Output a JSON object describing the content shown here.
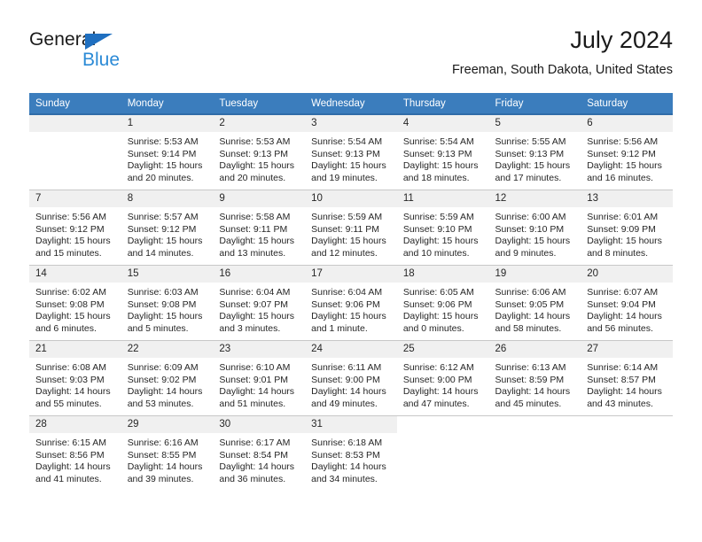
{
  "brand": {
    "name_dark": "General",
    "name_light": "Blue",
    "triangle_color": "#1f6fc0",
    "light_color": "#2b8ad6"
  },
  "header": {
    "title": "July 2024",
    "subtitle": "Freeman, South Dakota, United States"
  },
  "theme": {
    "header_bg": "#3b7dbd",
    "header_text": "#ffffff",
    "daynum_bg": "#f0f0f0",
    "row_divider": "#c8c8c8"
  },
  "weekdays": [
    "Sunday",
    "Monday",
    "Tuesday",
    "Wednesday",
    "Thursday",
    "Friday",
    "Saturday"
  ],
  "weeks": [
    [
      {
        "day": "",
        "sunrise": "",
        "sunset": "",
        "daylight1": "",
        "daylight2": "",
        "blank": true
      },
      {
        "day": "1",
        "sunrise": "Sunrise: 5:53 AM",
        "sunset": "Sunset: 9:14 PM",
        "daylight1": "Daylight: 15 hours",
        "daylight2": "and 20 minutes."
      },
      {
        "day": "2",
        "sunrise": "Sunrise: 5:53 AM",
        "sunset": "Sunset: 9:13 PM",
        "daylight1": "Daylight: 15 hours",
        "daylight2": "and 20 minutes."
      },
      {
        "day": "3",
        "sunrise": "Sunrise: 5:54 AM",
        "sunset": "Sunset: 9:13 PM",
        "daylight1": "Daylight: 15 hours",
        "daylight2": "and 19 minutes."
      },
      {
        "day": "4",
        "sunrise": "Sunrise: 5:54 AM",
        "sunset": "Sunset: 9:13 PM",
        "daylight1": "Daylight: 15 hours",
        "daylight2": "and 18 minutes."
      },
      {
        "day": "5",
        "sunrise": "Sunrise: 5:55 AM",
        "sunset": "Sunset: 9:13 PM",
        "daylight1": "Daylight: 15 hours",
        "daylight2": "and 17 minutes."
      },
      {
        "day": "6",
        "sunrise": "Sunrise: 5:56 AM",
        "sunset": "Sunset: 9:12 PM",
        "daylight1": "Daylight: 15 hours",
        "daylight2": "and 16 minutes."
      }
    ],
    [
      {
        "day": "7",
        "sunrise": "Sunrise: 5:56 AM",
        "sunset": "Sunset: 9:12 PM",
        "daylight1": "Daylight: 15 hours",
        "daylight2": "and 15 minutes."
      },
      {
        "day": "8",
        "sunrise": "Sunrise: 5:57 AM",
        "sunset": "Sunset: 9:12 PM",
        "daylight1": "Daylight: 15 hours",
        "daylight2": "and 14 minutes."
      },
      {
        "day": "9",
        "sunrise": "Sunrise: 5:58 AM",
        "sunset": "Sunset: 9:11 PM",
        "daylight1": "Daylight: 15 hours",
        "daylight2": "and 13 minutes."
      },
      {
        "day": "10",
        "sunrise": "Sunrise: 5:59 AM",
        "sunset": "Sunset: 9:11 PM",
        "daylight1": "Daylight: 15 hours",
        "daylight2": "and 12 minutes."
      },
      {
        "day": "11",
        "sunrise": "Sunrise: 5:59 AM",
        "sunset": "Sunset: 9:10 PM",
        "daylight1": "Daylight: 15 hours",
        "daylight2": "and 10 minutes."
      },
      {
        "day": "12",
        "sunrise": "Sunrise: 6:00 AM",
        "sunset": "Sunset: 9:10 PM",
        "daylight1": "Daylight: 15 hours",
        "daylight2": "and 9 minutes."
      },
      {
        "day": "13",
        "sunrise": "Sunrise: 6:01 AM",
        "sunset": "Sunset: 9:09 PM",
        "daylight1": "Daylight: 15 hours",
        "daylight2": "and 8 minutes."
      }
    ],
    [
      {
        "day": "14",
        "sunrise": "Sunrise: 6:02 AM",
        "sunset": "Sunset: 9:08 PM",
        "daylight1": "Daylight: 15 hours",
        "daylight2": "and 6 minutes."
      },
      {
        "day": "15",
        "sunrise": "Sunrise: 6:03 AM",
        "sunset": "Sunset: 9:08 PM",
        "daylight1": "Daylight: 15 hours",
        "daylight2": "and 5 minutes."
      },
      {
        "day": "16",
        "sunrise": "Sunrise: 6:04 AM",
        "sunset": "Sunset: 9:07 PM",
        "daylight1": "Daylight: 15 hours",
        "daylight2": "and 3 minutes."
      },
      {
        "day": "17",
        "sunrise": "Sunrise: 6:04 AM",
        "sunset": "Sunset: 9:06 PM",
        "daylight1": "Daylight: 15 hours",
        "daylight2": "and 1 minute."
      },
      {
        "day": "18",
        "sunrise": "Sunrise: 6:05 AM",
        "sunset": "Sunset: 9:06 PM",
        "daylight1": "Daylight: 15 hours",
        "daylight2": "and 0 minutes."
      },
      {
        "day": "19",
        "sunrise": "Sunrise: 6:06 AM",
        "sunset": "Sunset: 9:05 PM",
        "daylight1": "Daylight: 14 hours",
        "daylight2": "and 58 minutes."
      },
      {
        "day": "20",
        "sunrise": "Sunrise: 6:07 AM",
        "sunset": "Sunset: 9:04 PM",
        "daylight1": "Daylight: 14 hours",
        "daylight2": "and 56 minutes."
      }
    ],
    [
      {
        "day": "21",
        "sunrise": "Sunrise: 6:08 AM",
        "sunset": "Sunset: 9:03 PM",
        "daylight1": "Daylight: 14 hours",
        "daylight2": "and 55 minutes."
      },
      {
        "day": "22",
        "sunrise": "Sunrise: 6:09 AM",
        "sunset": "Sunset: 9:02 PM",
        "daylight1": "Daylight: 14 hours",
        "daylight2": "and 53 minutes."
      },
      {
        "day": "23",
        "sunrise": "Sunrise: 6:10 AM",
        "sunset": "Sunset: 9:01 PM",
        "daylight1": "Daylight: 14 hours",
        "daylight2": "and 51 minutes."
      },
      {
        "day": "24",
        "sunrise": "Sunrise: 6:11 AM",
        "sunset": "Sunset: 9:00 PM",
        "daylight1": "Daylight: 14 hours",
        "daylight2": "and 49 minutes."
      },
      {
        "day": "25",
        "sunrise": "Sunrise: 6:12 AM",
        "sunset": "Sunset: 9:00 PM",
        "daylight1": "Daylight: 14 hours",
        "daylight2": "and 47 minutes."
      },
      {
        "day": "26",
        "sunrise": "Sunrise: 6:13 AM",
        "sunset": "Sunset: 8:59 PM",
        "daylight1": "Daylight: 14 hours",
        "daylight2": "and 45 minutes."
      },
      {
        "day": "27",
        "sunrise": "Sunrise: 6:14 AM",
        "sunset": "Sunset: 8:57 PM",
        "daylight1": "Daylight: 14 hours",
        "daylight2": "and 43 minutes."
      }
    ],
    [
      {
        "day": "28",
        "sunrise": "Sunrise: 6:15 AM",
        "sunset": "Sunset: 8:56 PM",
        "daylight1": "Daylight: 14 hours",
        "daylight2": "and 41 minutes."
      },
      {
        "day": "29",
        "sunrise": "Sunrise: 6:16 AM",
        "sunset": "Sunset: 8:55 PM",
        "daylight1": "Daylight: 14 hours",
        "daylight2": "and 39 minutes."
      },
      {
        "day": "30",
        "sunrise": "Sunrise: 6:17 AM",
        "sunset": "Sunset: 8:54 PM",
        "daylight1": "Daylight: 14 hours",
        "daylight2": "and 36 minutes."
      },
      {
        "day": "31",
        "sunrise": "Sunrise: 6:18 AM",
        "sunset": "Sunset: 8:53 PM",
        "daylight1": "Daylight: 14 hours",
        "daylight2": "and 34 minutes."
      },
      {
        "day": "",
        "sunrise": "",
        "sunset": "",
        "daylight1": "",
        "daylight2": "",
        "empty": true
      },
      {
        "day": "",
        "sunrise": "",
        "sunset": "",
        "daylight1": "",
        "daylight2": "",
        "empty": true
      },
      {
        "day": "",
        "sunrise": "",
        "sunset": "",
        "daylight1": "",
        "daylight2": "",
        "empty": true
      }
    ]
  ]
}
